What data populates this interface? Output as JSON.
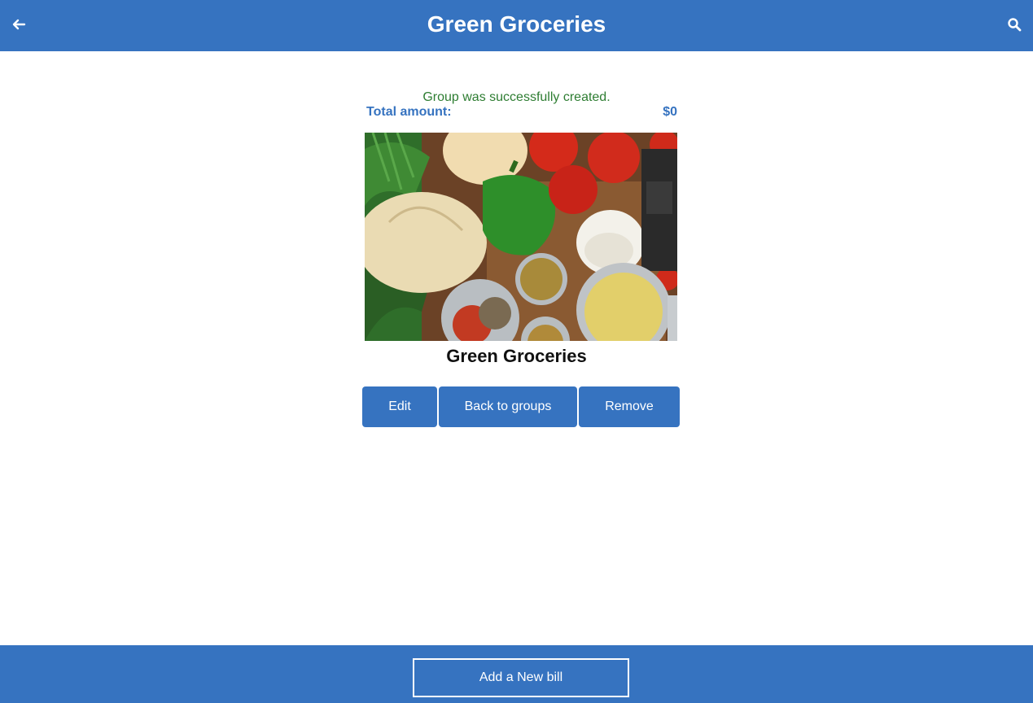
{
  "header": {
    "title": "Green Groceries",
    "back_icon": "arrow-left-icon",
    "search_icon": "search-icon"
  },
  "flash": {
    "message": "Group was successfully created."
  },
  "summary": {
    "total_label": "Total amount:",
    "total_value": "$0"
  },
  "group": {
    "name": "Green Groceries"
  },
  "actions": {
    "edit": "Edit",
    "back": "Back to groups",
    "remove": "Remove"
  },
  "footer": {
    "add_bill": "Add a New bill"
  },
  "colors": {
    "primary": "#3673c0",
    "success": "#2e7d32"
  }
}
